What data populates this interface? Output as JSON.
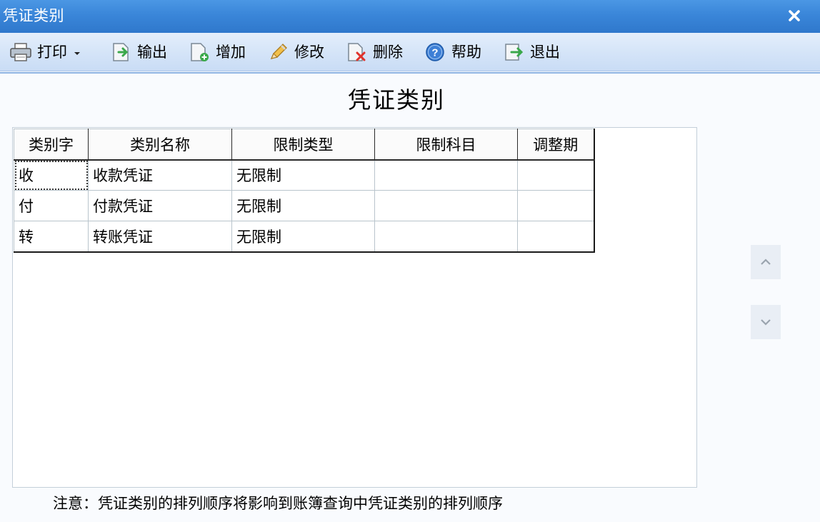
{
  "window": {
    "title": "凭证类别"
  },
  "toolbar": {
    "print_label": "打印",
    "export_label": "输出",
    "add_label": "增加",
    "edit_label": "修改",
    "delete_label": "删除",
    "help_label": "帮助",
    "exit_label": "退出"
  },
  "main": {
    "title": "凭证类别"
  },
  "table": {
    "headers": [
      "类别字",
      "类别名称",
      "限制类型",
      "限制科目",
      "调整期"
    ],
    "rows": [
      [
        "收",
        "收款凭证",
        "无限制",
        "",
        ""
      ],
      [
        "付",
        "付款凭证",
        "无限制",
        "",
        ""
      ],
      [
        "转",
        "转账凭证",
        "无限制",
        "",
        ""
      ]
    ]
  },
  "note": "注意：凭证类别的排列顺序将影响到账簿查询中凭证类别的排列顺序",
  "icons": {
    "print": "printer-icon",
    "dropdown": "caret-down-icon",
    "export": "export-icon",
    "add": "add-document-icon",
    "edit": "pencil-icon",
    "delete": "delete-document-icon",
    "help": "help-icon",
    "exit": "exit-icon",
    "close": "close-icon",
    "move_up": "chevron-up-icon",
    "move_down": "chevron-down-icon"
  },
  "colors": {
    "titlebar": "#3a86d9",
    "toolbar": "#d4e4f8",
    "background": "#f9fbfe"
  }
}
